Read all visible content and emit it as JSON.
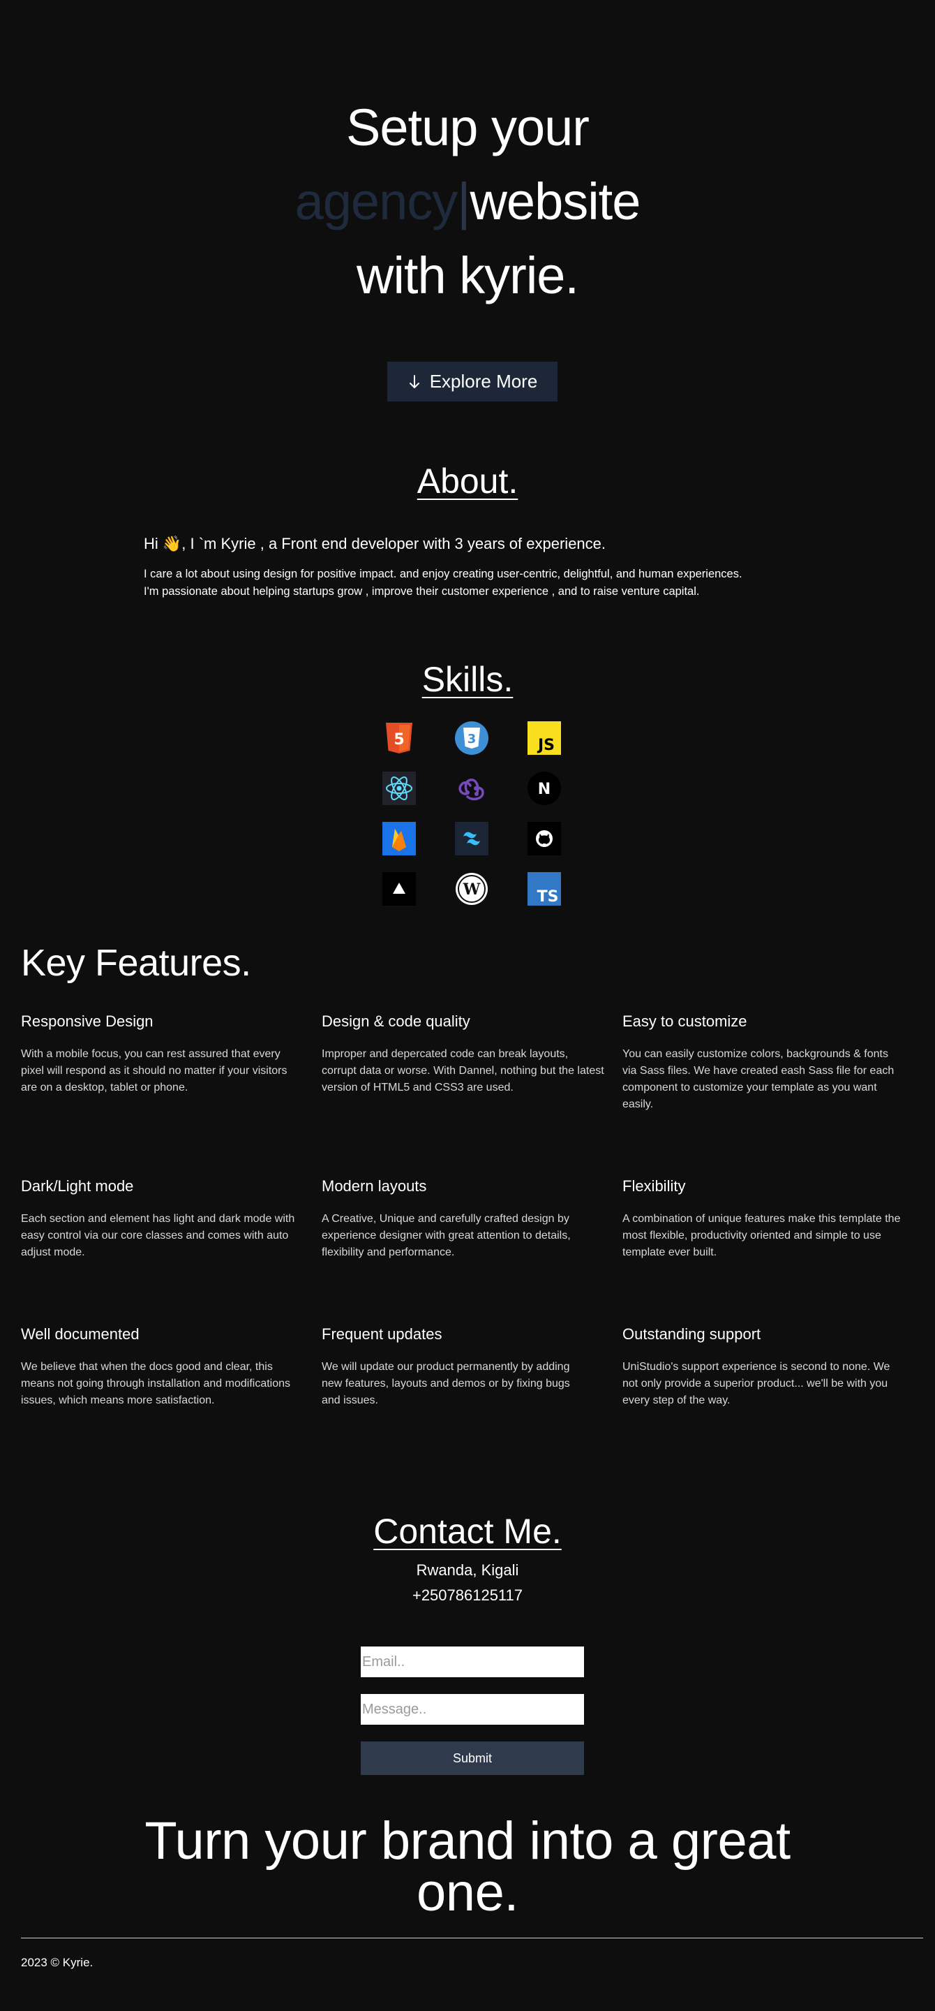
{
  "hero": {
    "line1": "Setup your",
    "typed_word": "agency",
    "cursor": "|",
    "line2_rest": "website",
    "line3": "with kyrie.",
    "explore_label": "Explore More"
  },
  "about": {
    "title": "About.",
    "greeting": "Hi 👋, I `m Kyrie , a Front end developer with 3 years of experience.",
    "paragraph_line1": "I care a lot about using design for positive impact. and enjoy creating user-centric, delightful, and human experiences.",
    "paragraph_line2": "I'm passionate about helping startups grow , improve their customer experience , and to raise venture capital."
  },
  "skills": {
    "title": "Skills.",
    "icons": [
      "html5-icon",
      "css3-icon",
      "javascript-icon",
      "react-icon",
      "redux-icon",
      "nextjs-icon",
      "firebase-icon",
      "tailwind-icon",
      "github-icon",
      "vercel-icon",
      "wordpress-icon",
      "typescript-icon"
    ],
    "labels": {
      "js": "JS",
      "ts": "TS",
      "next": "N",
      "wp": "W",
      "html": "5",
      "css": "3"
    }
  },
  "features": {
    "title": "Key Features.",
    "items": [
      {
        "title": "Responsive Design",
        "text": "With a mobile focus, you can rest assured that every pixel will respond as it should no matter if your visitors are on a desktop, tablet or phone."
      },
      {
        "title": "Design & code quality",
        "text": "Improper and depercated code can break layouts, corrupt data or worse. With Dannel, nothing but the latest version of HTML5 and CSS3 are used."
      },
      {
        "title": "Easy to customize",
        "text": "You can easily customize colors, backgrounds & fonts via Sass files. We have created eash Sass file for each component to customize your template as you want easily."
      },
      {
        "title": "Dark/Light mode",
        "text": "Each section and element has light and dark mode with easy control via our core classes and comes with auto adjust mode."
      },
      {
        "title": "Modern layouts",
        "text": "A Creative, Unique and carefully crafted design by experience designer with great attention to details, flexibility and performance."
      },
      {
        "title": "Flexibility",
        "text": "A combination of unique features make this template the most flexible, productivity oriented and simple to use template ever built."
      },
      {
        "title": "Well documented",
        "text": "We believe that when the docs good and clear, this means not going through installation and modifications issues, which means more satisfaction."
      },
      {
        "title": "Frequent updates",
        "text": "We will update our product permanently by adding new features, layouts and demos or by fixing bugs and issues."
      },
      {
        "title": "Outstanding support",
        "text": "UniStudio's support experience is second to none. We not only provide a superior product... we'll be with you every step of the way."
      }
    ]
  },
  "contact": {
    "title": "Contact Me.",
    "location": "Rwanda, Kigali",
    "phone": "+250786125117",
    "email_placeholder": "Email..",
    "message_placeholder": "Message..",
    "submit_label": "Submit"
  },
  "brand": {
    "line1": "Turn your brand into a great",
    "line2": "one."
  },
  "footer": {
    "copyright": "2023 © Kyrie."
  },
  "colors": {
    "background": "#0e0e0e",
    "button": "#1e2738",
    "submit": "#2f3b4d",
    "muted_text": "#1f2a3d"
  }
}
